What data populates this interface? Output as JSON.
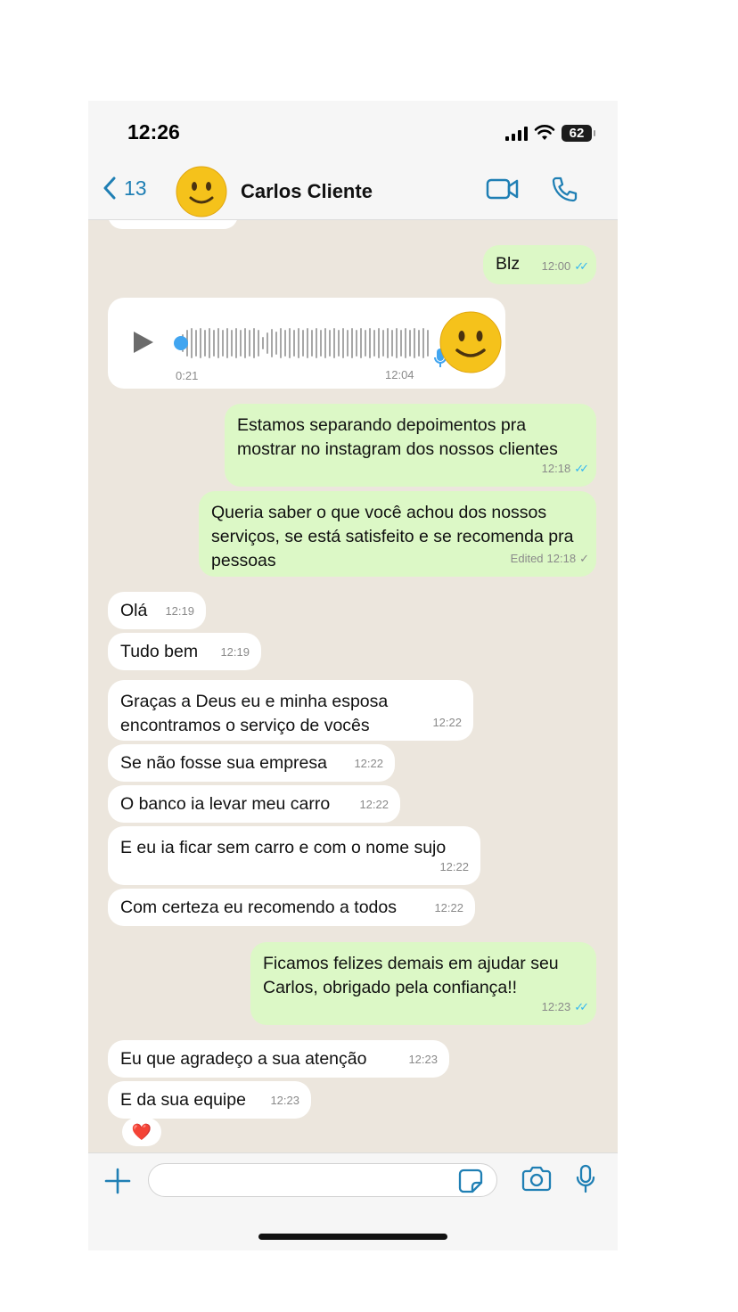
{
  "status": {
    "time": "12:26",
    "battery": "62"
  },
  "header": {
    "back_count": "13",
    "contact_name": "Carlos Cliente"
  },
  "voice_message": {
    "duration": "0:21",
    "time": "12:04"
  },
  "messages": [
    {
      "dir": "out",
      "text": "Blz",
      "time": "12:00",
      "status": "read"
    },
    {
      "dir": "out",
      "text": "Estamos separando depoimentos pra mostrar no instagram dos nossos clientes",
      "time": "12:18",
      "status": "read"
    },
    {
      "dir": "out",
      "text": "Queria saber o que você achou dos nossos serviços, se está satisfeito e se recomenda pra pessoas",
      "time": "12:18",
      "edited": "Edited",
      "status": "sent"
    },
    {
      "dir": "in",
      "text": "Olá",
      "time": "12:19"
    },
    {
      "dir": "in",
      "text": "Tudo bem",
      "time": "12:19"
    },
    {
      "dir": "in",
      "text": "Graças a Deus eu e minha esposa encontramos o serviço de vocês",
      "time": "12:22"
    },
    {
      "dir": "in",
      "text": "Se não fosse sua empresa",
      "time": "12:22"
    },
    {
      "dir": "in",
      "text": "O banco ia levar meu carro",
      "time": "12:22"
    },
    {
      "dir": "in",
      "text": "E eu ia ficar sem carro e com o nome sujo",
      "time": "12:22"
    },
    {
      "dir": "in",
      "text": "Com certeza eu recomendo a todos",
      "time": "12:22"
    },
    {
      "dir": "out",
      "text": "Ficamos felizes demais em ajudar seu Carlos, obrigado pela confiança!!",
      "time": "12:23",
      "status": "read"
    },
    {
      "dir": "in",
      "text": "Eu que agradeço a sua atenção",
      "time": "12:23"
    },
    {
      "dir": "in",
      "text": "E da sua equipe",
      "time": "12:23"
    }
  ],
  "reaction": {
    "emoji": "❤️"
  },
  "icons": {
    "back": "chevron-left-icon",
    "video": "video-call-icon",
    "phone": "phone-icon",
    "plus": "plus-icon",
    "sticker": "sticker-icon",
    "camera": "camera-icon",
    "mic": "microphone-icon"
  },
  "colors": {
    "accent": "#1f7fb4",
    "outgoing_bubble": "#dcf8c6",
    "incoming_bubble": "#ffffff",
    "chat_bg": "#ece6dd",
    "read_ticks": "#34b7f1"
  }
}
